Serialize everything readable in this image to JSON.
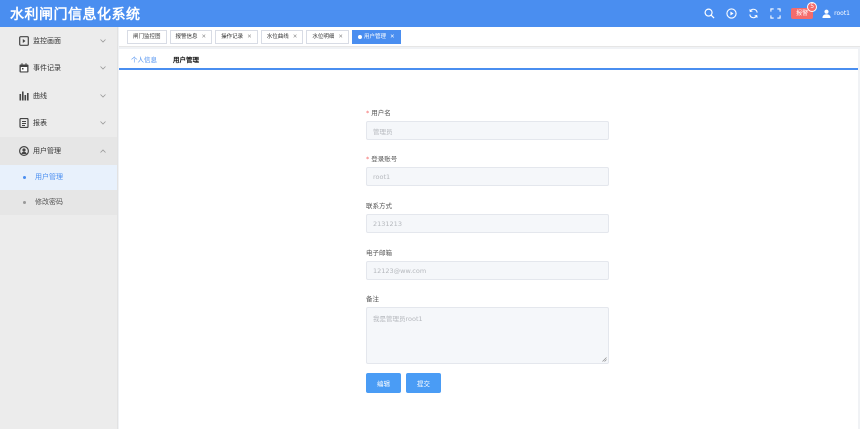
{
  "app": {
    "title": "水利闸门信息化系统"
  },
  "header": {
    "alarm_label": "报警",
    "alarm_count": "5",
    "username": "root1"
  },
  "sidebar": {
    "items": [
      {
        "label": "监控画面",
        "icon": "monitor-icon"
      },
      {
        "label": "事件记录",
        "icon": "calendar-icon"
      },
      {
        "label": "曲线",
        "icon": "bar-chart-icon"
      },
      {
        "label": "报表",
        "icon": "report-icon"
      },
      {
        "label": "用户管理",
        "icon": "user-manage-icon"
      }
    ],
    "sub_items": [
      {
        "label": "用户管理",
        "active": true
      },
      {
        "label": "修改密码",
        "active": false
      }
    ]
  },
  "tabs": [
    {
      "label": "闸门监控图",
      "closable": false
    },
    {
      "label": "报警信息",
      "closable": true
    },
    {
      "label": "操作记录",
      "closable": true
    },
    {
      "label": "水位曲线",
      "closable": true
    },
    {
      "label": "水位明细",
      "closable": true
    },
    {
      "label": "用户管理",
      "closable": true,
      "active": true
    }
  ],
  "subtabs": {
    "personal": "个人信息",
    "users": "用户管理"
  },
  "form": {
    "username": {
      "label": "用户名",
      "placeholder": "管理员",
      "required": true
    },
    "account": {
      "label": "登录账号",
      "placeholder": "root1",
      "required": true
    },
    "phone": {
      "label": "联系方式",
      "placeholder": "2131213",
      "required": false
    },
    "email": {
      "label": "电子邮箱",
      "placeholder": "12123@ww.com",
      "required": false
    },
    "remark": {
      "label": "备注",
      "placeholder": "我是管理员root1",
      "required": false
    },
    "edit_label": "编辑",
    "submit_label": "提交"
  },
  "colors": {
    "primary": "#4a8ef0",
    "alarm": "#f56c6c",
    "button": "#4a9cf5"
  }
}
